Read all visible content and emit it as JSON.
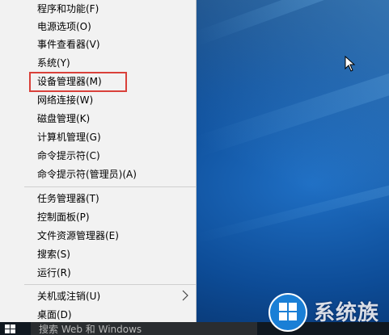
{
  "menu": {
    "items": [
      {
        "label": "程序和功能(F)"
      },
      {
        "label": "电源选项(O)"
      },
      {
        "label": "事件查看器(V)"
      },
      {
        "label": "系统(Y)"
      },
      {
        "label": "设备管理器(M)"
      },
      {
        "label": "网络连接(W)"
      },
      {
        "label": "磁盘管理(K)"
      },
      {
        "label": "计算机管理(G)"
      },
      {
        "label": "命令提示符(C)"
      },
      {
        "label": "命令提示符(管理员)(A)"
      },
      {
        "label": "任务管理器(T)"
      },
      {
        "label": "控制面板(P)"
      },
      {
        "label": "文件资源管理器(E)"
      },
      {
        "label": "搜索(S)"
      },
      {
        "label": "运行(R)"
      },
      {
        "label": "关机或注销(U)"
      },
      {
        "label": "桌面(D)"
      }
    ],
    "highlighted_item": "设备管理器(M)"
  },
  "taskbar": {
    "search_placeholder": "搜索 Web 和 Windows"
  },
  "watermark": {
    "text": "系统族"
  },
  "colors": {
    "menu_bg": "#f2f2f2",
    "highlight_border": "#d9403a",
    "desktop": "#0a3a78"
  }
}
